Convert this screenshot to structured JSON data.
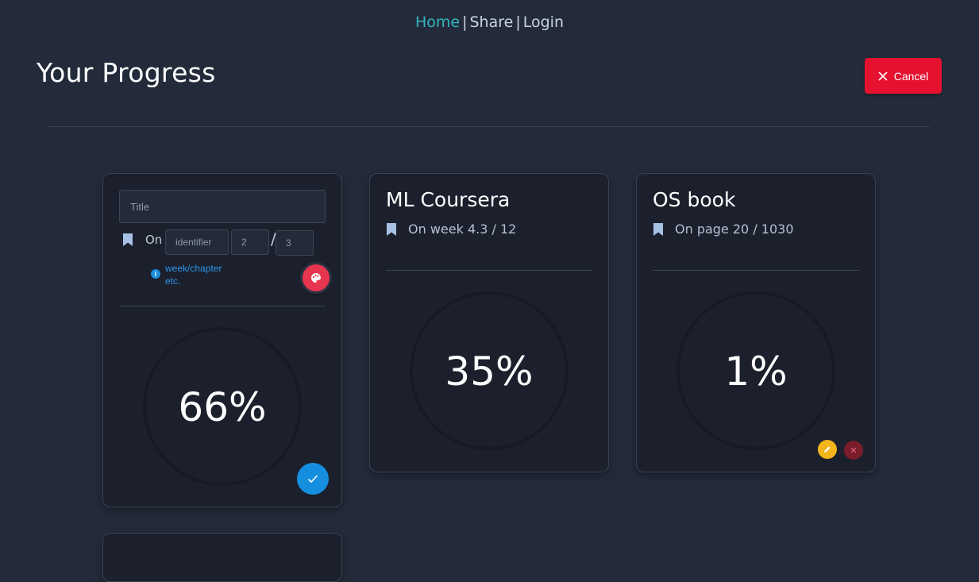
{
  "nav": {
    "home": "Home",
    "sep": "|",
    "share": "Share",
    "login": "Login"
  },
  "page": {
    "title": "Your Progress",
    "cancel_label": "Cancel"
  },
  "editor_card": {
    "title_placeholder": "Title",
    "on_label": "On",
    "identifier_placeholder": "identifier",
    "current_value": "2",
    "slash": "/",
    "total_value": "3",
    "hint": "week/chapter etc.",
    "percent_label": "66%",
    "progress_fraction": 0.66,
    "colors": {
      "gradient_start": "#f5503e",
      "gradient_end": "#d9317a"
    }
  },
  "cards": [
    {
      "title": "ML Coursera",
      "status": "On week 4.3 / 12",
      "percent_label": "35%",
      "progress_fraction": 0.35,
      "colors": {
        "start": "#6ce6c6",
        "end": "#1aa8e8"
      }
    },
    {
      "title": "OS book",
      "status": "On page 20 / 1030",
      "percent_label": "1%",
      "progress_fraction": 0.01,
      "colors": {
        "start": "#e0306d",
        "end": "#e0306d"
      }
    }
  ],
  "icons": {
    "cancel": "close-icon",
    "bookmark": "bookmark-icon",
    "info": "info-icon",
    "palette": "palette-icon",
    "check": "check-icon",
    "edit": "pencil-icon",
    "delete": "close-icon"
  }
}
